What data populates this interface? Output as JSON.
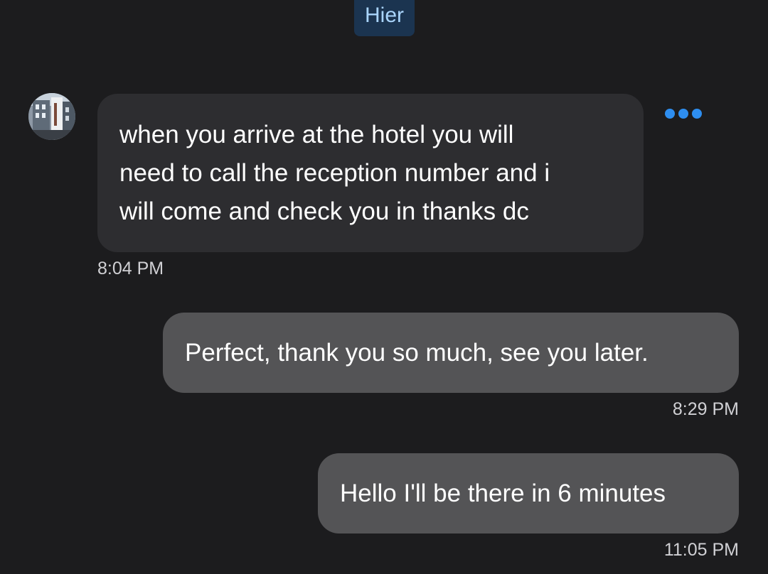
{
  "header": {
    "date_label": "Hier"
  },
  "colors": {
    "background": "#1c1c1e",
    "incoming_bubble": "#2d2d30",
    "outgoing_bubble": "#545456",
    "accent": "#2e8ef0",
    "date_chip_bg": "#1b3450",
    "date_chip_text": "#a9d4fb"
  },
  "messages": [
    {
      "direction": "incoming",
      "lines": [
        "when you arrive at the hotel you will",
        "need to call the reception number and i",
        "will come and check you in thanks dc"
      ],
      "time": "8:04 PM"
    },
    {
      "direction": "outgoing",
      "text": "Perfect, thank you so much, see you later.",
      "time": "8:29 PM"
    },
    {
      "direction": "outgoing",
      "text": "Hello I'll be there in 6 minutes",
      "time": "11:05 PM"
    }
  ],
  "icons": {
    "more": "more-horizontal-icon",
    "avatar": "hotel-photo-avatar"
  }
}
